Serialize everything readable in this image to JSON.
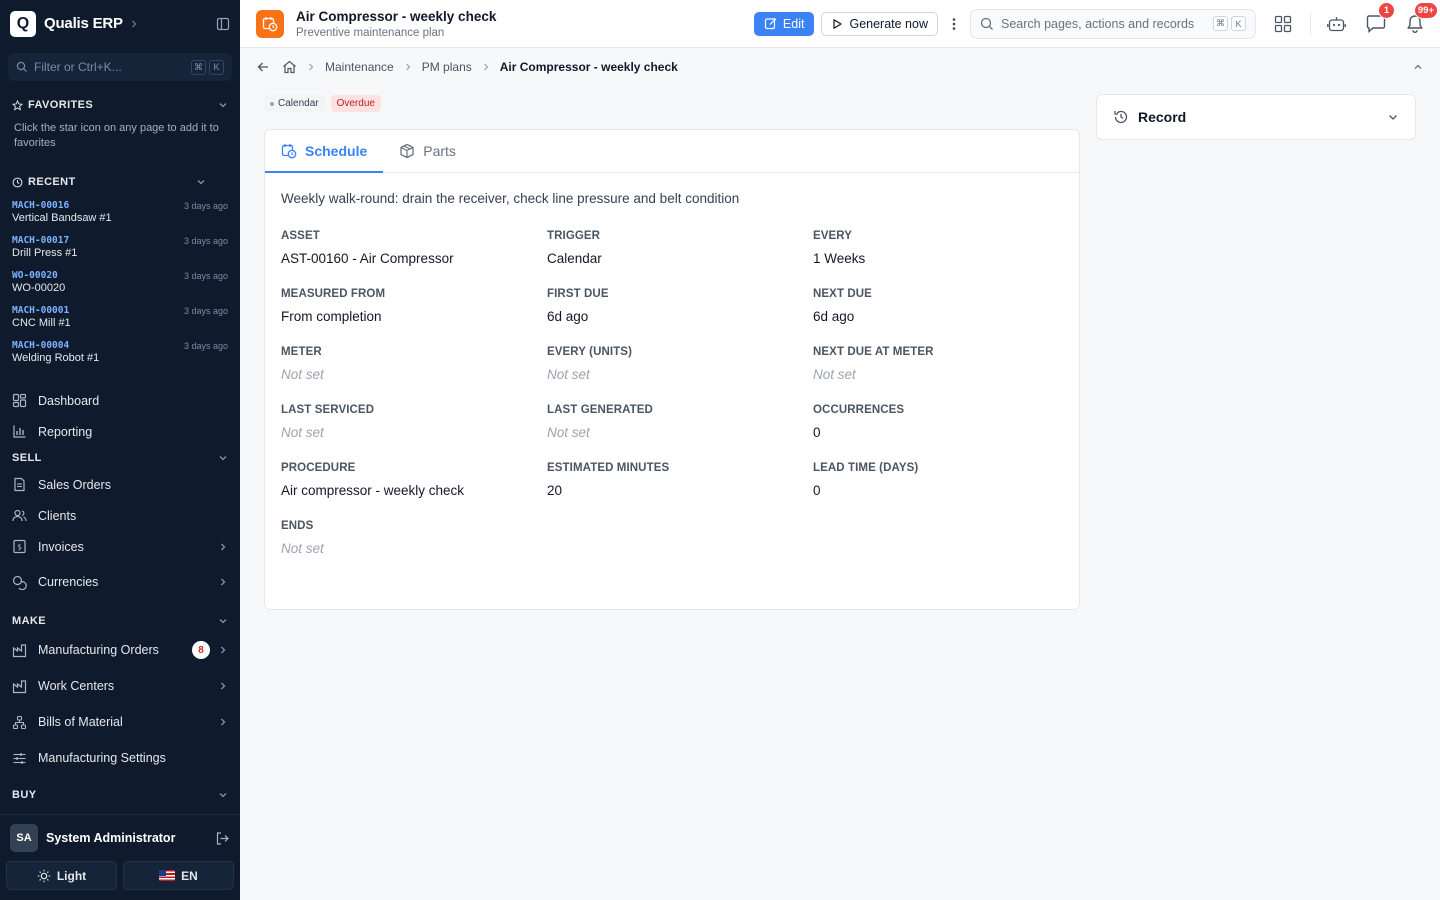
{
  "brand": {
    "logo_letter": "Q",
    "name": "Qualis ERP"
  },
  "sidebar": {
    "filter_placeholder": "Filter or Ctrl+K...",
    "kbd": [
      "⌘",
      "K"
    ],
    "favorites": {
      "title": "FAVORITES",
      "hint": "Click the star icon on any page to add it to favorites"
    },
    "recent": {
      "title": "RECENT",
      "items": [
        {
          "code": "MACH-00016",
          "name": "Vertical Bandsaw #1",
          "ago": "3 days ago"
        },
        {
          "code": "MACH-00017",
          "name": "Drill Press #1",
          "ago": "3 days ago"
        },
        {
          "code": "WO-00020",
          "name": "WO-00020",
          "ago": "3 days ago"
        },
        {
          "code": "MACH-00001",
          "name": "CNC Mill #1",
          "ago": "3 days ago"
        },
        {
          "code": "MACH-00004",
          "name": "Welding Robot #1",
          "ago": "3 days ago"
        }
      ]
    },
    "nav_top": [
      {
        "label": "Dashboard",
        "icon": "dashboard-icon"
      },
      {
        "label": "Reporting",
        "icon": "chart-icon"
      }
    ],
    "groups": {
      "sell": {
        "title": "SELL",
        "items": [
          {
            "label": "Sales Orders"
          },
          {
            "label": "Clients"
          },
          {
            "label": "Invoices"
          },
          {
            "label": "Currencies"
          }
        ]
      },
      "make": {
        "title": "MAKE",
        "items": [
          {
            "label": "Manufacturing Orders",
            "badge": "8"
          },
          {
            "label": "Work Centers"
          },
          {
            "label": "Bills of Material"
          },
          {
            "label": "Manufacturing Settings"
          }
        ]
      },
      "buy": {
        "title": "BUY"
      }
    },
    "user": {
      "initials": "SA",
      "name": "System Administrator"
    },
    "theme_label": "Light",
    "lang_label": "EN"
  },
  "topbar": {
    "title": "Air Compressor - weekly check",
    "subtitle": "Preventive maintenance plan",
    "edit_label": "Edit",
    "generate_label": "Generate now",
    "search_placeholder": "Search pages, actions and records",
    "search_kbd": [
      "⌘",
      "K"
    ],
    "chat_badge": "1",
    "bell_badge": "99+"
  },
  "breadcrumb": {
    "items": [
      "Maintenance",
      "PM plans"
    ],
    "current": "Air Compressor - weekly check"
  },
  "tags": {
    "trigger": "Calendar",
    "status": "Overdue"
  },
  "tabs": [
    {
      "label": "Schedule",
      "active": true
    },
    {
      "label": "Parts",
      "active": false
    }
  ],
  "description": "Weekly walk-round: drain the receiver, check line pressure and belt condition",
  "fields": [
    {
      "label": "ASSET",
      "value": "AST-00160 - Air Compressor"
    },
    {
      "label": "TRIGGER",
      "value": "Calendar"
    },
    {
      "label": "EVERY",
      "value": "1 Weeks"
    },
    {
      "label": "MEASURED FROM",
      "value": "From completion"
    },
    {
      "label": "FIRST DUE",
      "value": "6d ago"
    },
    {
      "label": "NEXT DUE",
      "value": "6d ago"
    },
    {
      "label": "METER",
      "value": "Not set",
      "muted": true
    },
    {
      "label": "EVERY (UNITS)",
      "value": "Not set",
      "muted": true
    },
    {
      "label": "NEXT DUE AT METER",
      "value": "Not set",
      "muted": true
    },
    {
      "label": "LAST SERVICED",
      "value": "Not set",
      "muted": true
    },
    {
      "label": "LAST GENERATED",
      "value": "Not set",
      "muted": true
    },
    {
      "label": "OCCURRENCES",
      "value": "0"
    },
    {
      "label": "PROCEDURE",
      "value": "Air compressor - weekly check"
    },
    {
      "label": "ESTIMATED MINUTES",
      "value": "20"
    },
    {
      "label": "LEAD TIME (DAYS)",
      "value": "0"
    },
    {
      "label": "ENDS",
      "value": "Not set",
      "muted": true
    }
  ],
  "record_panel": {
    "label": "Record"
  },
  "colors": {
    "accent": "#3b82f6",
    "sidebar_bg": "#0f1b2d",
    "page_icon": "#f97316",
    "danger": "#ef4444"
  }
}
